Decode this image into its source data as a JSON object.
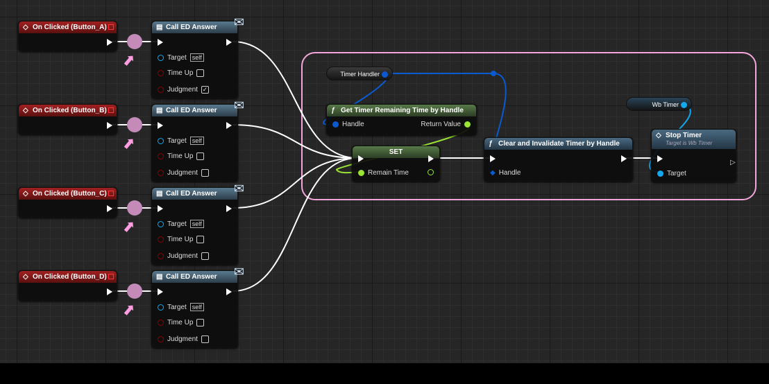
{
  "events": [
    {
      "title": "On Clicked (Button_A)"
    },
    {
      "title": "On Clicked (Button_B)"
    },
    {
      "title": "On Clicked (Button_C)"
    },
    {
      "title": "On Clicked (Button_D)"
    }
  ],
  "calls": [
    {
      "title": "Call ED Answer",
      "target": "Target",
      "target_value": "self",
      "time_up": "Time Up",
      "time_up_checked": false,
      "judgment": "Judgment",
      "judgment_checked": true
    },
    {
      "title": "Call ED Answer",
      "target": "Target",
      "target_value": "self",
      "time_up": "Time Up",
      "time_up_checked": false,
      "judgment": "Judgment",
      "judgment_checked": false
    },
    {
      "title": "Call ED Answer",
      "target": "Target",
      "target_value": "self",
      "time_up": "Time Up",
      "time_up_checked": false,
      "judgment": "Judgment",
      "judgment_checked": false
    },
    {
      "title": "Call ED Answer",
      "target": "Target",
      "target_value": "self",
      "time_up": "Time Up",
      "time_up_checked": false,
      "judgment": "Judgment",
      "judgment_checked": false
    }
  ],
  "timer_handler": "Timer Handler",
  "get_timer": {
    "title": "Get Timer Remaining Time by Handle",
    "handle": "Handle",
    "return": "Return Value"
  },
  "set": {
    "title": "SET",
    "var": "Remain Time"
  },
  "clear": {
    "title": "Clear and Invalidate Timer by Handle",
    "handle": "Handle"
  },
  "wb_timer": "Wb Timer",
  "stop": {
    "title": "Stop Timer",
    "subtitle": "Target is Wb Timer",
    "target": "Target"
  },
  "colors": {
    "comment": "#f4a6dc",
    "exec": "#ffffff",
    "struct": "#0a5ad0",
    "float": "#9be436",
    "object": "#14a8ef",
    "bool": "#8c0000"
  }
}
